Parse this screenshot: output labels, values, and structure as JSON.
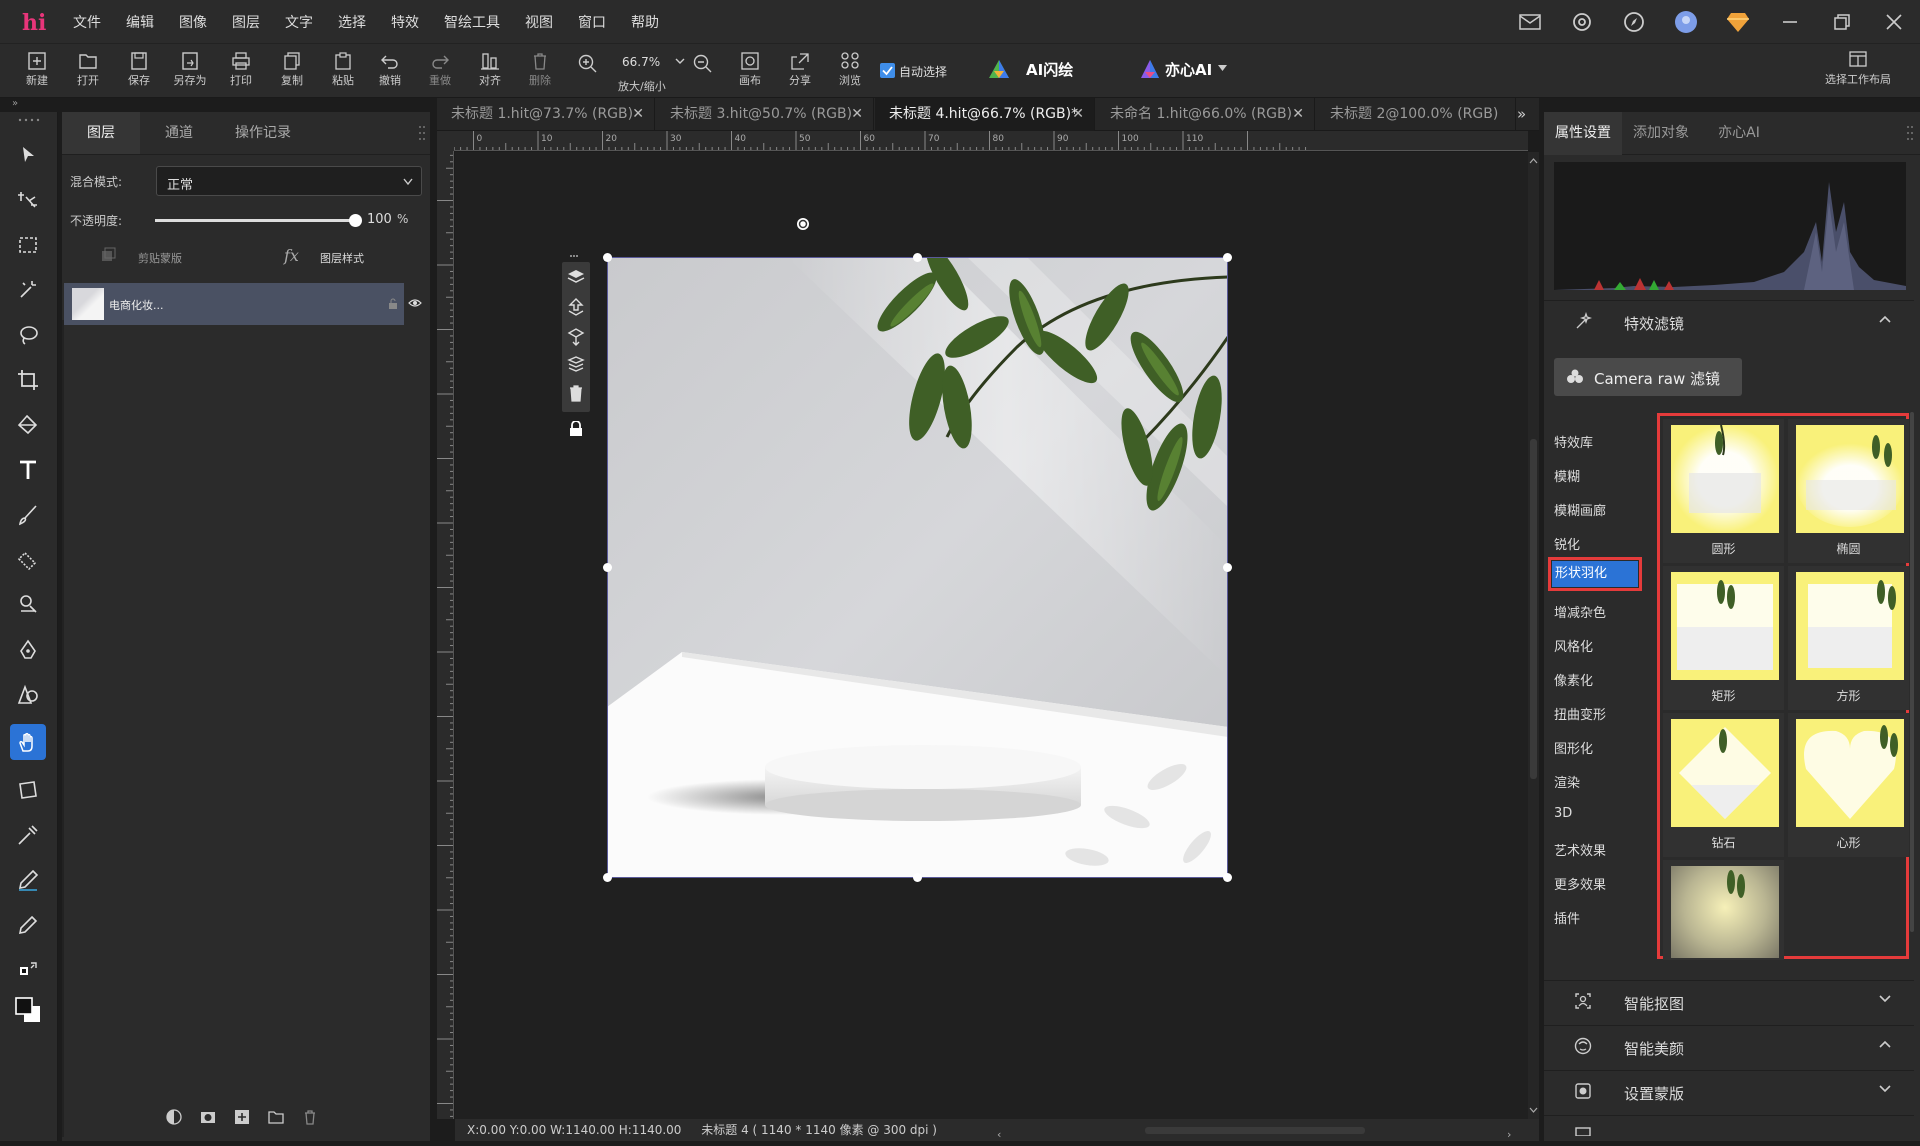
{
  "app": {
    "logo": "hi"
  },
  "menu": [
    "文件",
    "编辑",
    "图像",
    "图层",
    "文字",
    "选择",
    "特效",
    "智绘工具",
    "视图",
    "窗口",
    "帮助"
  ],
  "toolbar": {
    "new": "新建",
    "open": "打开",
    "save": "保存",
    "save_as": "另存为",
    "print": "打印",
    "copy": "复制",
    "paste": "粘贴",
    "undo": "撤销",
    "redo": "重做",
    "align": "对齐",
    "delete": "删除",
    "zoom_value": "66.7%",
    "zoom": "放大/缩小",
    "canvas": "画布",
    "share": "分享",
    "browse": "浏览",
    "auto_select": "自动选择",
    "ai_flash": "AI闪绘",
    "yixin_ai": "亦心AI",
    "workspace": "选择工作布局"
  },
  "layers_panel": {
    "tabs": [
      "图层",
      "通道",
      "操作记录"
    ],
    "blend_label": "混合模式:",
    "blend_value": "正常",
    "opacity_label": "不透明度:",
    "opacity_value": "100",
    "opacity_unit": "%",
    "opacity_fraction": 1.0,
    "clip_mask": "剪贴蒙版",
    "layer_style": "图层样式",
    "layer_name": "电商化妆..."
  },
  "doc_tabs": [
    {
      "label": "未标题 1.hit@73.7% (RGB)",
      "active": false
    },
    {
      "label": "未标题 3.hit@50.7% (RGB)",
      "active": false
    },
    {
      "label": "未标题 4.hit@66.7% (RGB)*",
      "active": true
    },
    {
      "label": "未命名 1.hit@66.0% (RGB)",
      "active": false
    },
    {
      "label": "未标题 2@100.0% (RGB)",
      "active": false
    }
  ],
  "ruler_labels": [
    "10",
    "0",
    "10",
    "20",
    "30",
    "40",
    "50",
    "60",
    "70",
    "80",
    "90",
    "100",
    "110"
  ],
  "status": {
    "coords": "X:0.00 Y:0.00 W:1140.00 H:1140.00",
    "doc": "未标题 4 ( 1140 * 1140 像素 @ 300 dpi )"
  },
  "right_panel": {
    "tabs": [
      "属性设置",
      "添加对象",
      "亦心AI"
    ],
    "effects_title": "特效滤镜",
    "camera_raw": "Camera raw 滤镜",
    "categories": [
      "特效库",
      "模糊",
      "模糊画廊",
      "锐化",
      "形状羽化",
      "增减杂色",
      "风格化",
      "像素化",
      "扭曲变形",
      "图形化",
      "渲染",
      "3D",
      "艺术效果",
      "更多效果",
      "插件"
    ],
    "active_category": "形状羽化",
    "presets": [
      "圆形",
      "椭圆",
      "矩形",
      "方形",
      "钻石",
      "心形"
    ],
    "smart_cutout": "智能抠图",
    "smart_beauty": "智能美颜",
    "set_mask": "设置蒙版"
  },
  "colors": {
    "accent": "#2b73d6",
    "highlight_red": "#e53b3b",
    "preset_yellow": "#f9f17a"
  }
}
